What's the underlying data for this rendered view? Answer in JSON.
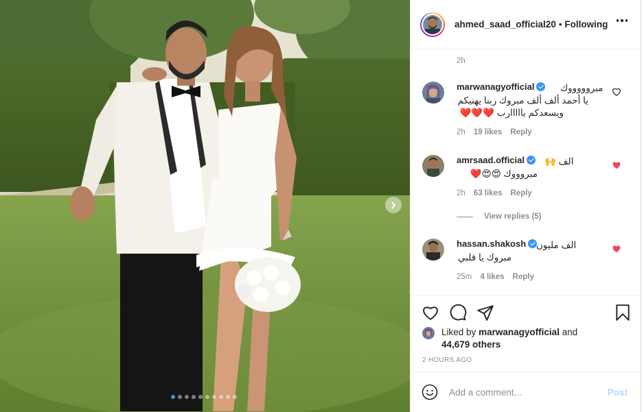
{
  "post": {
    "username": "ahmed_saad_official20",
    "separator": "•",
    "follow_status": "Following",
    "top_time": "2h",
    "carousel": {
      "slides": 10,
      "active_index": 0
    }
  },
  "comments": [
    {
      "username": "marwanagyofficial",
      "verified": true,
      "line1": "مبروووووك",
      "line2": "يا أحمد ألف ألف مبروك ربنا يهنيكم",
      "line3": "ويسعدكم يااااارب ❤️❤️❤️",
      "time": "2h",
      "likes": "19 likes",
      "reply": "Reply",
      "liked": false
    },
    {
      "username": "amrsaad.official",
      "verified": true,
      "line1": "الف 🙌",
      "line2": "مبروووك 😍😍❤️",
      "time": "2h",
      "likes": "63 likes",
      "reply": "Reply",
      "liked": true,
      "view_replies": "View replies (5)"
    },
    {
      "username": "hassan.shakosh",
      "verified": true,
      "line1": "الف مليون",
      "line2": "مبروك يا قلبي",
      "time": "25m",
      "likes": "4 likes",
      "reply": "Reply",
      "liked": true
    }
  ],
  "likes_summary": {
    "prefix": "Liked by",
    "user": "marwanagyofficial",
    "and": "and",
    "others": "44,679 others"
  },
  "date_label": "2 HOURS AGO",
  "add_comment": {
    "placeholder": "Add a comment...",
    "post_label": "Post"
  },
  "colors": {
    "accent": "#3897f0",
    "liked_heart": "#ed4956",
    "muted": "#8e8e8e",
    "post_disabled": "#b3dbff"
  },
  "icons": [
    "more-options-icon",
    "heart-icon",
    "comment-icon",
    "share-icon",
    "bookmark-icon",
    "emoji-icon",
    "next-arrow-icon",
    "verified-icon"
  ]
}
